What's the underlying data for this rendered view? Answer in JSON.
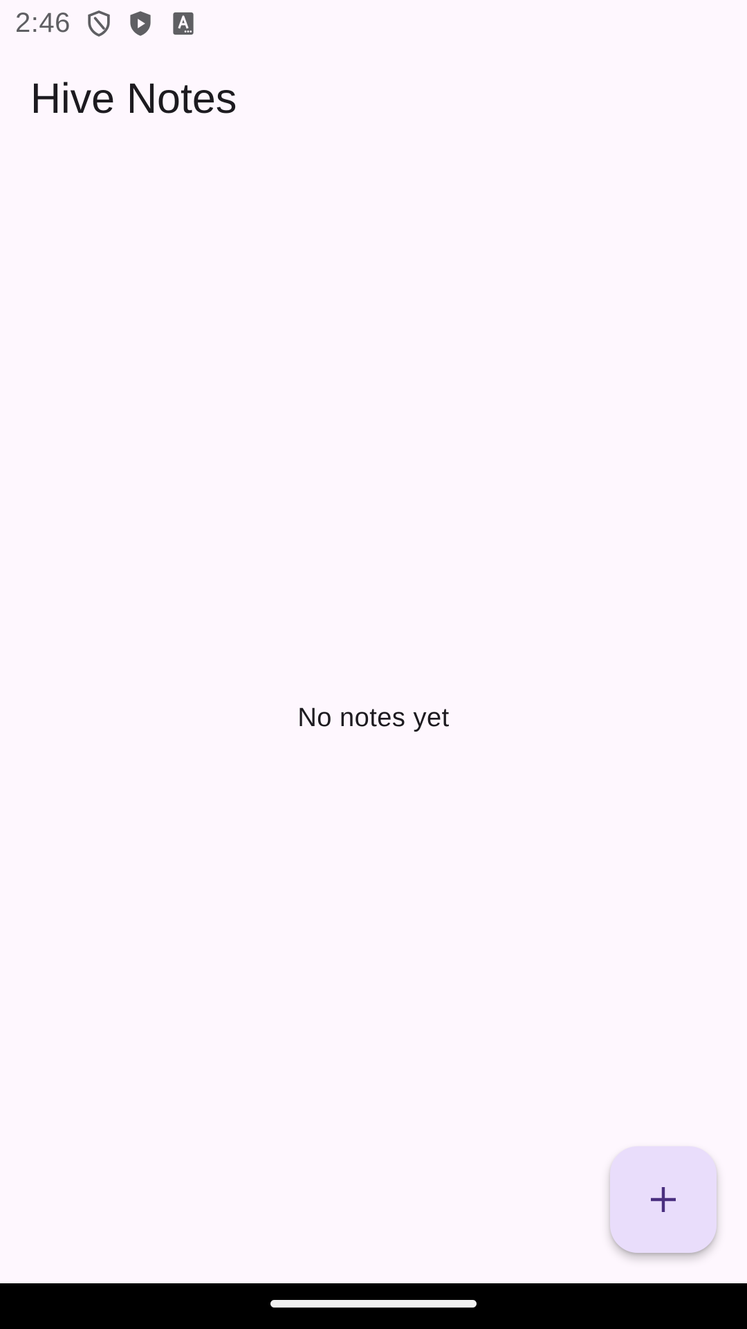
{
  "status_bar": {
    "time": "2:46",
    "icons": [
      "shield-outline-icon",
      "play-shield-icon",
      "text-a-icon"
    ],
    "icon_color": "#5f5f63"
  },
  "app_bar": {
    "title": "Hive Notes"
  },
  "main": {
    "empty_message": "No notes yet"
  },
  "fab": {
    "icon": "plus-icon",
    "background": "#e9ddfb",
    "icon_color": "#4a2f7f"
  },
  "colors": {
    "background": "#fef7fe",
    "text": "#1d1b20",
    "nav_bar": "#000000"
  }
}
